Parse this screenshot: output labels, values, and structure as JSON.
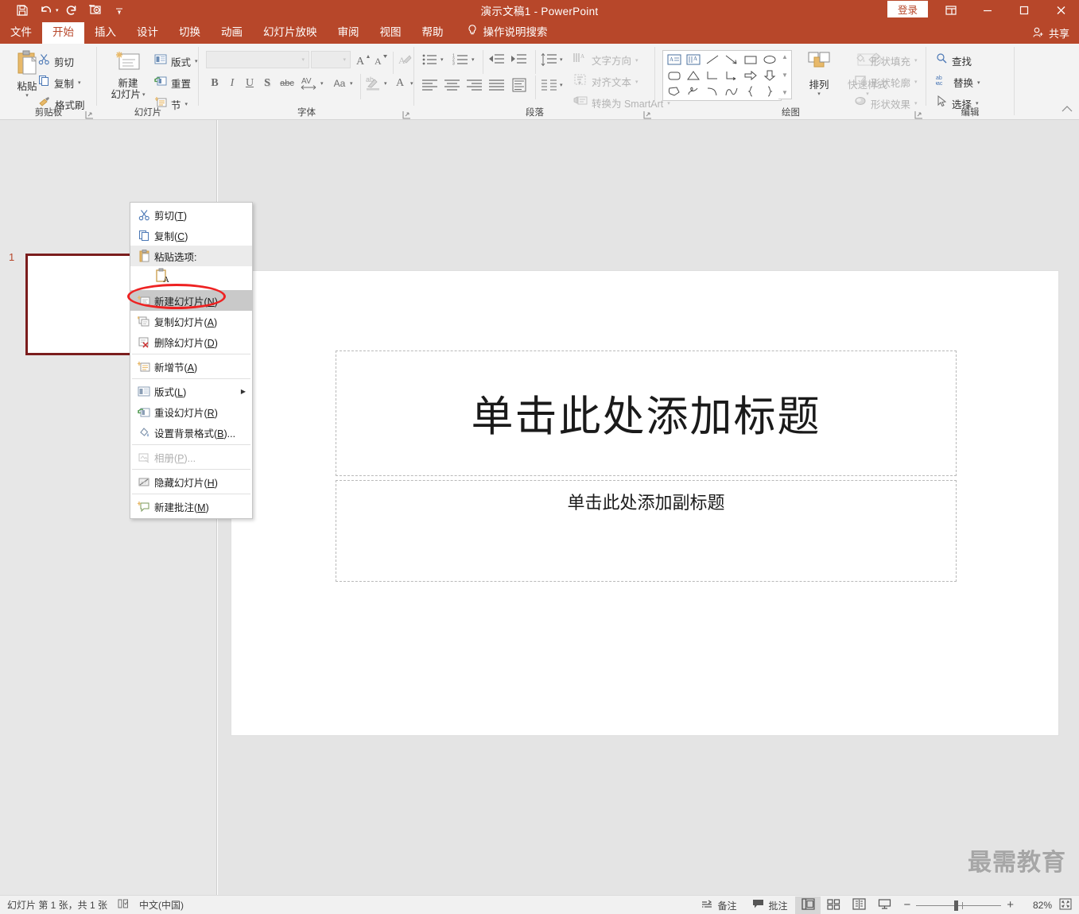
{
  "titlebar": {
    "document_title": "演示文稿1  -  PowerPoint",
    "signin_label": "登录",
    "qat": [
      {
        "name": "save-icon",
        "label": "保存"
      },
      {
        "name": "undo-icon",
        "label": "撤销"
      },
      {
        "name": "redo-icon",
        "label": "重复"
      },
      {
        "name": "start-slideshow-icon",
        "label": "从头开始"
      },
      {
        "name": "customize-qat-icon",
        "label": "自定义快速访问工具栏"
      }
    ],
    "window_controls": [
      {
        "name": "ribbon-display-options-icon",
        "label": "功能区显示选项"
      },
      {
        "name": "minimize-icon",
        "label": "最小化"
      },
      {
        "name": "maximize-icon",
        "label": "最大化"
      },
      {
        "name": "close-icon",
        "label": "关闭"
      }
    ]
  },
  "tabs": [
    {
      "label": "文件",
      "active": false
    },
    {
      "label": "开始",
      "active": true
    },
    {
      "label": "插入",
      "active": false
    },
    {
      "label": "设计",
      "active": false
    },
    {
      "label": "切换",
      "active": false
    },
    {
      "label": "动画",
      "active": false
    },
    {
      "label": "幻灯片放映",
      "active": false
    },
    {
      "label": "审阅",
      "active": false
    },
    {
      "label": "视图",
      "active": false
    },
    {
      "label": "帮助",
      "active": false
    }
  ],
  "tellme": {
    "label": "操作说明搜索",
    "icon": "lightbulb-icon"
  },
  "share": {
    "label": "共享",
    "icon": "share-person-icon"
  },
  "ribbon": {
    "groups": [
      {
        "name": "clipboard",
        "label": "剪贴板"
      },
      {
        "name": "slides",
        "label": "幻灯片"
      },
      {
        "name": "font",
        "label": "字体"
      },
      {
        "name": "paragraph",
        "label": "段落"
      },
      {
        "name": "drawing",
        "label": "绘图"
      },
      {
        "name": "editing",
        "label": "编辑"
      }
    ],
    "clipboard": {
      "paste": "粘贴",
      "cut": "剪切",
      "copy": "复制",
      "format_painter": "格式刷"
    },
    "slides": {
      "new_slide": "新建\n幻灯片",
      "new_slide_line1": "新建",
      "new_slide_line2": "幻灯片",
      "layout": "版式",
      "reset": "重置",
      "section": "节"
    },
    "font": {
      "font_name_value": "",
      "font_size_value": "",
      "grow_font": "A",
      "shrink_font": "A",
      "clear_formatting": "清除所有格式",
      "bold": "B",
      "italic": "I",
      "underline": "U",
      "shadow": "S",
      "strikethrough": "abc",
      "character_spacing": "AV",
      "change_case": "Aa",
      "text_highlight": "ab",
      "font_color": "A"
    },
    "paragraph": {
      "text_direction": "文字方向",
      "align_text": "对齐文本",
      "convert_smartart": "转换为 SmartArt"
    },
    "drawing": {
      "arrange": "排列",
      "quick_styles": "快速样式",
      "shape_fill": "形状填充",
      "shape_outline": "形状轮廓",
      "shape_effects": "形状效果"
    },
    "editing": {
      "find": "查找",
      "replace": "替换",
      "select": "选择"
    }
  },
  "thumbnail_pane": {
    "slide_number": "1"
  },
  "slide": {
    "title_placeholder": "单击此处添加标题",
    "subtitle_placeholder": "单击此处添加副标题"
  },
  "watermark": "最需教育",
  "context_menu": {
    "items": [
      {
        "label": "剪切",
        "accel": "T",
        "icon": "scissors-icon",
        "kind": "item",
        "state": "normal"
      },
      {
        "label": "复制",
        "accel": "C",
        "icon": "copy-icon",
        "kind": "item",
        "state": "normal"
      },
      {
        "label": "粘贴选项:",
        "accel": "",
        "icon": "paste-icon",
        "kind": "header",
        "state": "normal"
      },
      {
        "label": "",
        "accel": "",
        "icon": "paste-keep-text-only-icon",
        "kind": "paste-buttons",
        "state": "normal"
      },
      {
        "label": "新建幻灯片",
        "accel": "N",
        "icon": "new-slide-icon",
        "kind": "item",
        "state": "selected"
      },
      {
        "label": "复制幻灯片",
        "accel": "A",
        "icon": "duplicate-slide-icon",
        "kind": "item",
        "state": "normal"
      },
      {
        "label": "删除幻灯片",
        "accel": "D",
        "icon": "delete-slide-icon",
        "kind": "item",
        "state": "normal"
      },
      {
        "label": "新增节",
        "accel": "A",
        "icon": "add-section-icon",
        "kind": "item",
        "state": "normal"
      },
      {
        "label": "版式",
        "accel": "L",
        "icon": "layout-icon",
        "kind": "submenu",
        "state": "normal"
      },
      {
        "label": "重设幻灯片",
        "accel": "R",
        "icon": "reset-slide-icon",
        "kind": "item",
        "state": "normal"
      },
      {
        "label": "设置背景格式",
        "accel": "B",
        "suffix": "...",
        "icon": "format-background-icon",
        "kind": "item",
        "state": "normal"
      },
      {
        "label": "相册",
        "accel": "P",
        "suffix": "...",
        "icon": "photo-album-icon",
        "kind": "item",
        "state": "disabled"
      },
      {
        "label": "隐藏幻灯片",
        "accel": "H",
        "icon": "hide-slide-icon",
        "kind": "item",
        "state": "normal"
      },
      {
        "label": "新建批注",
        "accel": "M",
        "icon": "new-comment-icon",
        "kind": "item",
        "state": "normal"
      }
    ],
    "highlight_color": "#ee2222"
  },
  "statusbar": {
    "slide_count": "幻灯片 第 1 张，共 1 张",
    "accessibility_icon": "accessibility-check-icon",
    "language": "中文(中国)",
    "notes": "备注",
    "comments": "批注",
    "views": [
      {
        "name": "normal-view",
        "icon": "normal-view-icon",
        "active": true
      },
      {
        "name": "slide-sorter-view",
        "icon": "slide-sorter-icon",
        "active": false
      },
      {
        "name": "reading-view",
        "icon": "reading-view-icon",
        "active": false
      },
      {
        "name": "slideshow-view",
        "icon": "slideshow-icon",
        "active": false
      }
    ],
    "zoom_out": "−",
    "zoom_in": "+",
    "zoom_level": "82%",
    "fit_to_window": "使幻灯片适应当前窗口"
  },
  "colors": {
    "accent": "#b7472a",
    "selection_border": "#7b1d1d",
    "annotation": "#ee2222"
  }
}
